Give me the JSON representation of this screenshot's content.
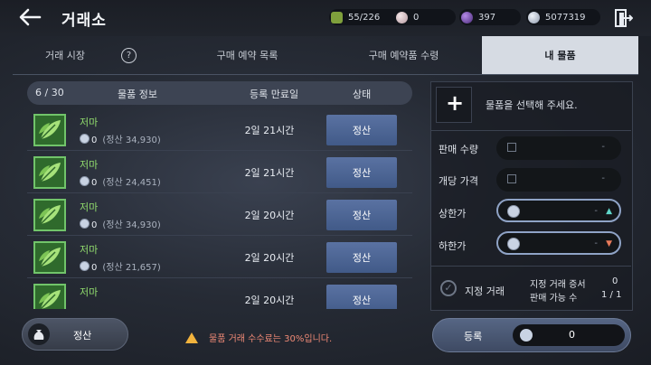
{
  "header": {
    "title": "거래소",
    "inventory": "55/226",
    "currency_pearl": "0",
    "currency_purple": "397",
    "currency_silver": "5077319"
  },
  "tabs": [
    {
      "label": "거래 시장",
      "active": false
    },
    {
      "label": "구매 예약 목록",
      "active": false
    },
    {
      "label": "구매 예약품 수령",
      "active": false
    },
    {
      "label": "내 물품",
      "active": true
    }
  ],
  "list": {
    "count": "6 / 30",
    "columns": {
      "info": "물품 정보",
      "expiry": "등록 만료일",
      "status": "상태"
    },
    "items": [
      {
        "name": "저마",
        "price": "0",
        "settle": "(정산 34,930)",
        "expiry": "2일 21시간",
        "button": "정산"
      },
      {
        "name": "저마",
        "price": "0",
        "settle": "(정산 24,451)",
        "expiry": "2일 21시간",
        "button": "정산"
      },
      {
        "name": "저마",
        "price": "0",
        "settle": "(정산 34,930)",
        "expiry": "2일 20시간",
        "button": "정산"
      },
      {
        "name": "저마",
        "price": "0",
        "settle": "(정산 21,657)",
        "expiry": "2일 20시간",
        "button": "정산"
      },
      {
        "name": "저마",
        "price": "",
        "settle": "",
        "expiry": "2일 20시간",
        "button": "정산"
      }
    ]
  },
  "panel": {
    "prompt": "물품을 선택해 주세요.",
    "qty_label": "판매 수량",
    "qty_value": "-",
    "unit_label": "개당 가격",
    "unit_value": "-",
    "upper_label": "상한가",
    "upper_value": "-",
    "lower_label": "하한가",
    "lower_value": "-",
    "designated_label": "지정 거래",
    "cert_label": "지정 거래 증서",
    "cert_value": "0",
    "avail_label": "판매 가능 수",
    "avail_value": "1 / 1"
  },
  "footer": {
    "settle_label": "정산",
    "warning": "물품 거래 수수료는 30%입니다.",
    "register_label": "등록",
    "register_value": "0"
  },
  "colors": {
    "item_name": "#8fd96c",
    "warning": "#f08a76",
    "active_tab": "#d6dbe3"
  }
}
